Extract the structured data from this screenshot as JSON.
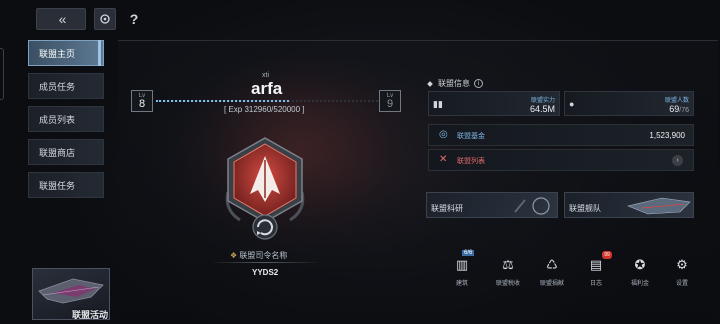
{
  "topbar": {
    "back_glyph": "«",
    "help_glyph": "?"
  },
  "sidebar": {
    "items": [
      {
        "label": "联盟主页",
        "active": true
      },
      {
        "label": "成员任务"
      },
      {
        "label": "成员列表"
      },
      {
        "label": "联盟商店"
      },
      {
        "label": "联盟任务"
      }
    ]
  },
  "activity": {
    "label": "联盟活动"
  },
  "profile": {
    "tag": "xti",
    "name": "arfa",
    "level_label": "Lv",
    "level": "8",
    "next_level": "9",
    "exp_text": "[ Exp 312960/520000 ]",
    "exp_progress": 0.6,
    "commander_label": "联盟司令名称",
    "commander_name": "YYDS2"
  },
  "info": {
    "title": "联盟信息",
    "power_label": "联盟实力",
    "power_value": "64.5M",
    "members_label": "联盟人数",
    "members_value": "69",
    "members_max": "/76",
    "fund_label": "联盟基金",
    "fund_value": "1,523,900",
    "list_label": "联盟列表"
  },
  "cards": {
    "research": "联盟科研",
    "fleet": "联盟舰队"
  },
  "toolbar": {
    "items": [
      {
        "label": "建筑",
        "icon": "building-icon",
        "badge": "6/6"
      },
      {
        "label": "联盟税收",
        "icon": "scale-icon"
      },
      {
        "label": "联盟捐献",
        "icon": "donate-icon"
      },
      {
        "label": "日志",
        "icon": "log-icon",
        "badge": "99"
      },
      {
        "label": "福利金",
        "icon": "bonus-icon"
      },
      {
        "label": "设置",
        "icon": "gear-icon"
      }
    ]
  },
  "colors": {
    "accent": "#7fb6e6",
    "emblem_red": "#b3362f",
    "warning": "#e36b6b"
  }
}
